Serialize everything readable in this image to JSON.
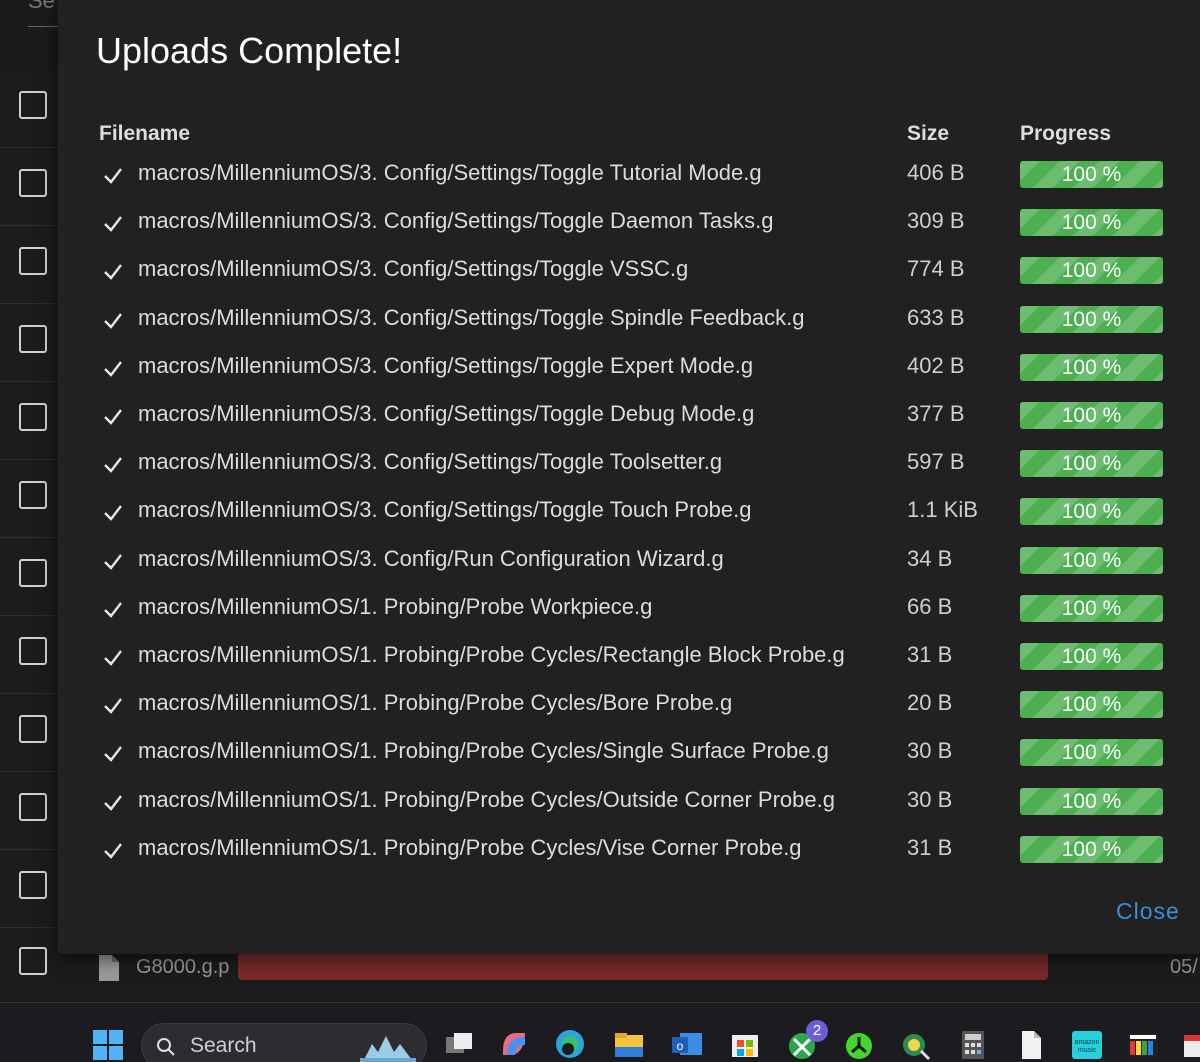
{
  "background": {
    "search_partial": "Se",
    "bottom_file_name": "G8000.g.p",
    "bottom_date_partial": "05/"
  },
  "dialog": {
    "title": "Uploads Complete!",
    "columns": {
      "filename": "Filename",
      "size": "Size",
      "progress": "Progress"
    },
    "rows": [
      {
        "name": "macros/MillenniumOS/3. Config/Settings/Toggle Tutorial Mode.g",
        "size": "406 B",
        "progress": 100,
        "progress_label": "100 %"
      },
      {
        "name": "macros/MillenniumOS/3. Config/Settings/Toggle Daemon Tasks.g",
        "size": "309 B",
        "progress": 100,
        "progress_label": "100 %"
      },
      {
        "name": "macros/MillenniumOS/3. Config/Settings/Toggle VSSC.g",
        "size": "774 B",
        "progress": 100,
        "progress_label": "100 %"
      },
      {
        "name": "macros/MillenniumOS/3. Config/Settings/Toggle Spindle Feedback.g",
        "size": "633 B",
        "progress": 100,
        "progress_label": "100 %"
      },
      {
        "name": "macros/MillenniumOS/3. Config/Settings/Toggle Expert Mode.g",
        "size": "402 B",
        "progress": 100,
        "progress_label": "100 %"
      },
      {
        "name": "macros/MillenniumOS/3. Config/Settings/Toggle Debug Mode.g",
        "size": "377 B",
        "progress": 100,
        "progress_label": "100 %"
      },
      {
        "name": "macros/MillenniumOS/3. Config/Settings/Toggle Toolsetter.g",
        "size": "597 B",
        "progress": 100,
        "progress_label": "100 %"
      },
      {
        "name": "macros/MillenniumOS/3. Config/Settings/Toggle Touch Probe.g",
        "size": "1.1 KiB",
        "progress": 100,
        "progress_label": "100 %"
      },
      {
        "name": "macros/MillenniumOS/3. Config/Run Configuration Wizard.g",
        "size": "34 B",
        "progress": 100,
        "progress_label": "100 %"
      },
      {
        "name": "macros/MillenniumOS/1. Probing/Probe Workpiece.g",
        "size": "66 B",
        "progress": 100,
        "progress_label": "100 %"
      },
      {
        "name": "macros/MillenniumOS/1. Probing/Probe Cycles/Rectangle Block Probe.g",
        "size": "31 B",
        "progress": 100,
        "progress_label": "100 %"
      },
      {
        "name": "macros/MillenniumOS/1. Probing/Probe Cycles/Bore Probe.g",
        "size": "20 B",
        "progress": 100,
        "progress_label": "100 %"
      },
      {
        "name": "macros/MillenniumOS/1. Probing/Probe Cycles/Single Surface Probe.g",
        "size": "30 B",
        "progress": 100,
        "progress_label": "100 %"
      },
      {
        "name": "macros/MillenniumOS/1. Probing/Probe Cycles/Outside Corner Probe.g",
        "size": "30 B",
        "progress": 100,
        "progress_label": "100 %"
      },
      {
        "name": "macros/MillenniumOS/1. Probing/Probe Cycles/Vise Corner Probe.g",
        "size": "31 B",
        "progress": 100,
        "progress_label": "100 %"
      }
    ],
    "close_label": "Close"
  },
  "taskbar": {
    "search_label": "Search",
    "xbox_badge": "2",
    "icons": [
      "start-icon",
      "task-view-icon",
      "copilot-icon",
      "edge-icon",
      "file-explorer-icon",
      "outlook-icon",
      "store-icon",
      "xbox-icon",
      "razer-icon",
      "app-icon",
      "calculator-icon",
      "document-icon",
      "amazon-music-icon",
      "media-app-icon"
    ]
  },
  "colors": {
    "accent": "#3b8fd8",
    "progress": "#4caf50",
    "danger_bar": "#7a2a2a"
  }
}
